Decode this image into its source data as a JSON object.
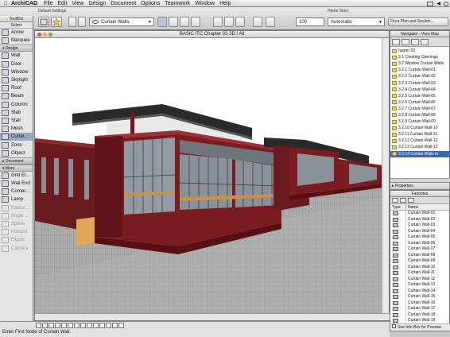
{
  "menubar": {
    "apple": "",
    "app_name": "ArchiCAD",
    "menus": [
      "File",
      "Edit",
      "View",
      "Design",
      "Document",
      "Options",
      "Teamwork",
      "Window",
      "Help"
    ]
  },
  "toolbar": {
    "toolbox_label": "ToolBox",
    "default_settings": "Default Settings",
    "tool_selector": "Curtain Walls",
    "zoom_value": "100",
    "home_story_label": "Home Story",
    "story_value": "Automatic",
    "floorplan_button": "Floor Plan and Section..."
  },
  "toolbox": {
    "title": "ToolBox",
    "select_label": "Select",
    "selection_tools": [
      {
        "label": "Arrow",
        "icon": "arrow-icon"
      },
      {
        "label": "Marquee",
        "icon": "marquee-icon"
      }
    ],
    "design_label": "Design",
    "design_tools": [
      {
        "label": "Wall",
        "icon": "wall-icon"
      },
      {
        "label": "Door",
        "icon": "door-icon"
      },
      {
        "label": "Window",
        "icon": "window-icon"
      },
      {
        "label": "Skylight",
        "icon": "skylight-icon"
      },
      {
        "label": "Roof",
        "icon": "roof-icon"
      },
      {
        "label": "Beam",
        "icon": "beam-icon"
      },
      {
        "label": "Column",
        "icon": "column-icon"
      },
      {
        "label": "Slab",
        "icon": "slab-icon"
      },
      {
        "label": "Stair",
        "icon": "stair-icon"
      },
      {
        "label": "Mesh",
        "icon": "mesh-icon"
      },
      {
        "label": "Curtai...",
        "icon": "curtain-wall-icon"
      },
      {
        "label": "Zone",
        "icon": "zone-icon"
      },
      {
        "label": "Object",
        "icon": "object-icon"
      }
    ],
    "document_label": "Document",
    "more_label": "More",
    "more_tools": [
      {
        "label": "Grid El...",
        "icon": "grid-element-icon"
      },
      {
        "label": "Wall End",
        "icon": "wall-end-icon"
      },
      {
        "label": "Corner...",
        "icon": "corner-window-icon"
      },
      {
        "label": "Lamp",
        "icon": "lamp-icon"
      },
      {
        "label": "Radial ...",
        "icon": "radial-icon"
      },
      {
        "label": "Angle ...",
        "icon": "angle-icon"
      },
      {
        "label": "Spline",
        "icon": "spline-icon"
      },
      {
        "label": "Hotspot",
        "icon": "hotspot-icon"
      },
      {
        "label": "Figure",
        "icon": "figure-icon"
      },
      {
        "label": "Camera",
        "icon": "camera-icon"
      }
    ]
  },
  "window3d": {
    "title": "BASIC ITC Chapter 03 3D / All"
  },
  "navigator": {
    "title": "Navigator - View Map",
    "items": [
      "hapter 03",
      "3.1 Creating Openings",
      "3.2 Window Curtain Walls",
      "3.2.1 Curtain Wall-01",
      "3.2.2 Curtain Wall-02",
      "3.2.3 Curtain Wall-03",
      "3.2.4 Curtain Wall-04",
      "3.2.5 Curtain Wall-05",
      "3.2.6 Curtain Wall-06",
      "3.2.7 Curtain Wall-07",
      "3.2.8 Curtain Wall-08",
      "3.2.9 Curtain Wall-09",
      "3.2.10 Curtain Wall-10",
      "3.2.11 Curtain Wall-11",
      "3.2.12 Curtain Wall-12",
      "3.2.13 Curtain Wall-13",
      "3.2.14 Curtain Walls in"
    ]
  },
  "properties": {
    "title": "Properties"
  },
  "favorites": {
    "title": "Favorites",
    "col_type": "Type",
    "col_name": "Name",
    "items": [
      "Curtain Wall-01",
      "Curtain Wall-02",
      "Curtain Wall-03",
      "Curtain Wall-04",
      "Curtain Wall-05",
      "Curtain Wall-06",
      "Curtain Wall-07",
      "Curtain Wall-08",
      "Curtain Wall-09",
      "Curtain Wall-10",
      "Curtain Wall-11",
      "Curtain Wall-12",
      "Curtain Wall-13",
      "Curtain Wall-14",
      "Curtain Wall-15",
      "Curtain Wall-16",
      "Curtain Wall-17",
      "Curtain Wall-18",
      "Curtain Wall-19"
    ],
    "footer": "See Info Box for Preview"
  },
  "status": {
    "message": "Enter First Node of Curtain Wall."
  },
  "colors": {
    "brick": "#7a1d22",
    "glass": "#8b9198",
    "roof": "#2a2a2a",
    "selection": "#3d66b3"
  }
}
